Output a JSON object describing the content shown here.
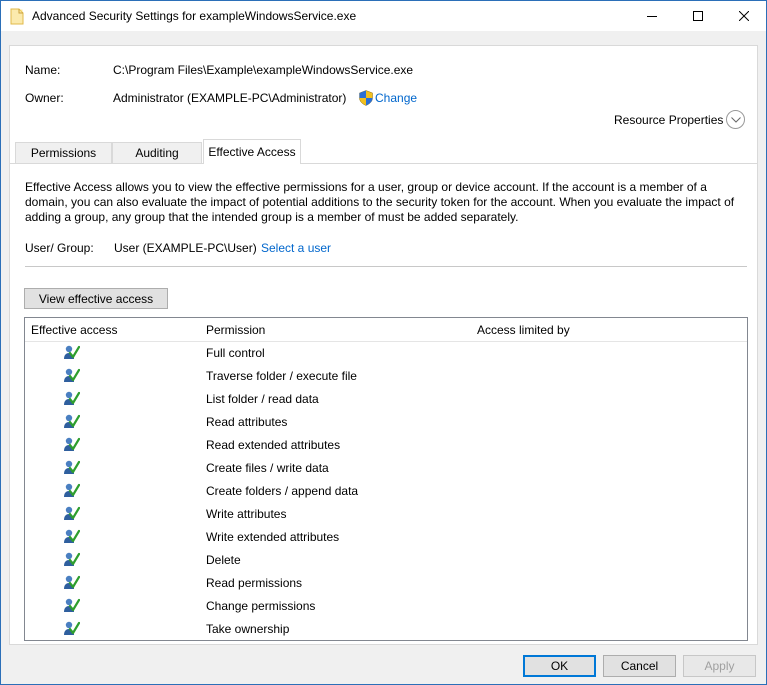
{
  "window": {
    "title": "Advanced Security Settings for exampleWindowsService.exe"
  },
  "header": {
    "name_label": "Name:",
    "name_value": "C:\\Program Files\\Example\\exampleWindowsService.exe",
    "owner_label": "Owner:",
    "owner_value": "Administrator (EXAMPLE-PC\\Administrator)",
    "change_link": "Change",
    "resource_properties": "Resource Properties"
  },
  "tabs": [
    {
      "label": "Permissions",
      "active": false
    },
    {
      "label": "Auditing",
      "active": false
    },
    {
      "label": "Effective Access",
      "active": true
    }
  ],
  "effective_access": {
    "description": "Effective Access allows you to view the effective permissions for a user, group or device account. If the account is a member of a domain, you can also evaluate the impact of potential additions to the security token for the account. When you evaluate the impact of adding a group, any group that the intended group is a member of must be added separately.",
    "user_group_label": "User/ Group:",
    "user_group_value": "User (EXAMPLE-PC\\User)",
    "select_user_link": "Select a user",
    "view_button": "View effective access"
  },
  "table": {
    "columns": [
      "Effective access",
      "Permission",
      "Access limited by"
    ],
    "rows": [
      {
        "permission": "Full control",
        "icon": "user-check-icon"
      },
      {
        "permission": "Traverse folder / execute file",
        "icon": "user-check-icon"
      },
      {
        "permission": "List folder / read data",
        "icon": "user-check-icon"
      },
      {
        "permission": "Read attributes",
        "icon": "user-check-icon"
      },
      {
        "permission": "Read extended attributes",
        "icon": "user-check-icon"
      },
      {
        "permission": "Create files / write data",
        "icon": "user-check-icon"
      },
      {
        "permission": "Create folders / append data",
        "icon": "user-check-icon"
      },
      {
        "permission": "Write attributes",
        "icon": "user-check-icon"
      },
      {
        "permission": "Write extended attributes",
        "icon": "user-check-icon"
      },
      {
        "permission": "Delete",
        "icon": "user-check-icon"
      },
      {
        "permission": "Read permissions",
        "icon": "user-check-icon"
      },
      {
        "permission": "Change permissions",
        "icon": "user-check-icon"
      },
      {
        "permission": "Take ownership",
        "icon": "user-check-icon"
      }
    ]
  },
  "footer": {
    "ok": "OK",
    "cancel": "Cancel",
    "apply": "Apply"
  },
  "colors": {
    "link": "#0066cc",
    "accent": "#0078d7",
    "check_green": "#2e9e2e"
  }
}
